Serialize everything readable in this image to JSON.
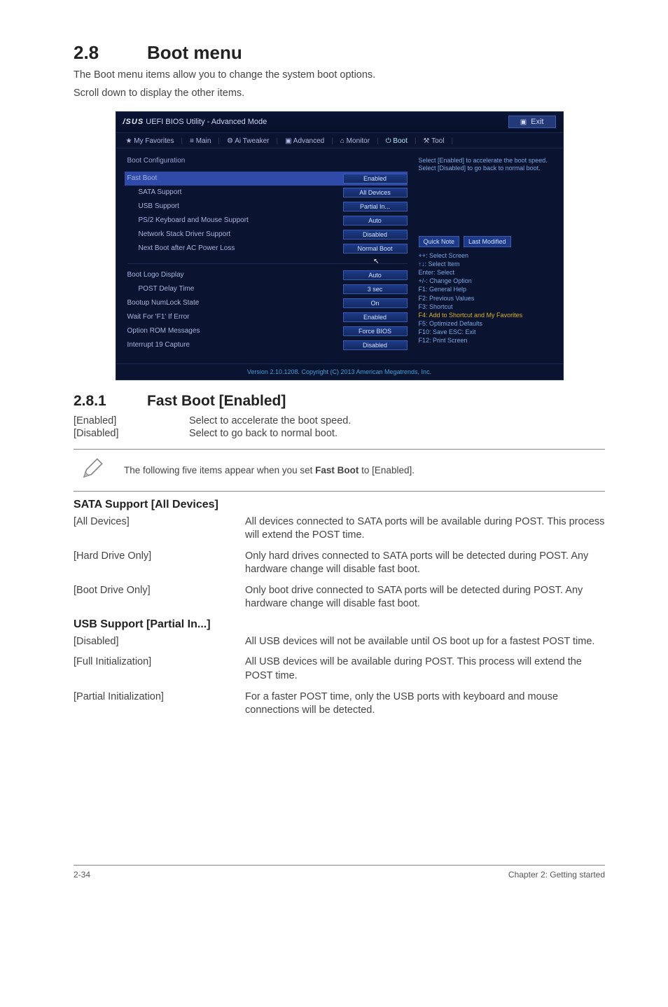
{
  "section": {
    "number": "2.8",
    "title": "Boot menu"
  },
  "intro": [
    "The Boot menu items allow you to change the system boot options.",
    "Scroll down to display the other items."
  ],
  "bios": {
    "brand": "/SUS",
    "title": "UEFI BIOS Utility - Advanced Mode",
    "exit": "Exit",
    "tabs": [
      "★ My Favorites",
      "≡ Main",
      "⚙ Ai Tweaker",
      "▣ Advanced",
      "⌂ Monitor",
      "⏻ Boot",
      "⚒ Tool"
    ],
    "active_tab": 5,
    "config_header": "Boot Configuration",
    "rows": [
      {
        "label": "Fast Boot",
        "value": "Enabled",
        "highlight": true
      },
      {
        "label": "SATA Support",
        "value": "All Devices",
        "indent": true
      },
      {
        "label": "USB Support",
        "value": "Partial In...",
        "indent": true
      },
      {
        "label": "PS/2 Keyboard and Mouse Support",
        "value": "Auto",
        "indent": true
      },
      {
        "label": "Network Stack Driver Support",
        "value": "Disabled",
        "indent": true
      },
      {
        "label": "Next Boot after AC Power Loss",
        "value": "Normal Boot",
        "indent": true
      }
    ],
    "rows2": [
      {
        "label": "Boot Logo Display",
        "value": "Auto"
      },
      {
        "label": "POST Delay Time",
        "value": "3 sec",
        "indent": true
      },
      {
        "label": "Bootup NumLock State",
        "value": "On"
      },
      {
        "label": "Wait For 'F1' If Error",
        "value": "Enabled"
      },
      {
        "label": "Option ROM Messages",
        "value": "Force BIOS"
      },
      {
        "label": "Interrupt 19 Capture",
        "value": "Disabled"
      }
    ],
    "help_top": "Select [Enabled] to accelerate the boot speed. Select [Disabled] to go back to normal boot.",
    "quick_note": "Quick Note",
    "last_modified": "Last Modified",
    "help_keys": [
      {
        "t": "++: Select Screen"
      },
      {
        "t": "↑↓: Select Item"
      },
      {
        "t": "Enter: Select"
      },
      {
        "t": "+/-: Change Option"
      },
      {
        "t": "F1: General Help"
      },
      {
        "t": "F2: Previous Values"
      },
      {
        "t": "F3: Shortcut"
      },
      {
        "t": "F4: Add to Shortcut and My Favorites",
        "hl": true
      },
      {
        "t": "F5: Optimized Defaults"
      },
      {
        "t": "F10: Save  ESC: Exit"
      },
      {
        "t": "F12: Print Screen"
      }
    ],
    "footer": "Version 2.10.1208. Copyright (C) 2013 American Megatrends, Inc."
  },
  "subsection": {
    "number": "2.8.1",
    "title": "Fast Boot [Enabled]"
  },
  "fastboot_opts": [
    {
      "key": "[Enabled]",
      "val": "Select to accelerate the boot speed."
    },
    {
      "key": "[Disabled]",
      "val": "Select to go back to normal boot."
    }
  ],
  "note": {
    "prefix": "The following five items appear when you set ",
    "bold": "Fast Boot",
    "suffix": " to [Enabled]."
  },
  "sata": {
    "title": "SATA Support [All Devices]",
    "rows": [
      {
        "key": "[All Devices]",
        "val": "All devices connected to SATA ports will be available during POST. This process will extend the POST time."
      },
      {
        "key": "[Hard Drive Only]",
        "val": "Only hard drives connected to SATA ports will be detected during POST. Any hardware change will disable fast boot."
      },
      {
        "key": "[Boot Drive Only]",
        "val": "Only boot drive connected to SATA ports will be detected during POST. Any hardware change will disable fast boot."
      }
    ]
  },
  "usb": {
    "title": "USB Support [Partial In...]",
    "rows": [
      {
        "key": "[Disabled]",
        "val": "All USB devices will not be available until OS boot up for a fastest POST time."
      },
      {
        "key": "[Full Initialization]",
        "val": "All USB devices will be available during POST. This process will extend the POST time."
      },
      {
        "key": "[Partial Initialization]",
        "val": "For a faster POST time, only the USB ports with keyboard and mouse connections will be detected."
      }
    ]
  },
  "footer": {
    "left": "2-34",
    "right": "Chapter 2: Getting started"
  }
}
